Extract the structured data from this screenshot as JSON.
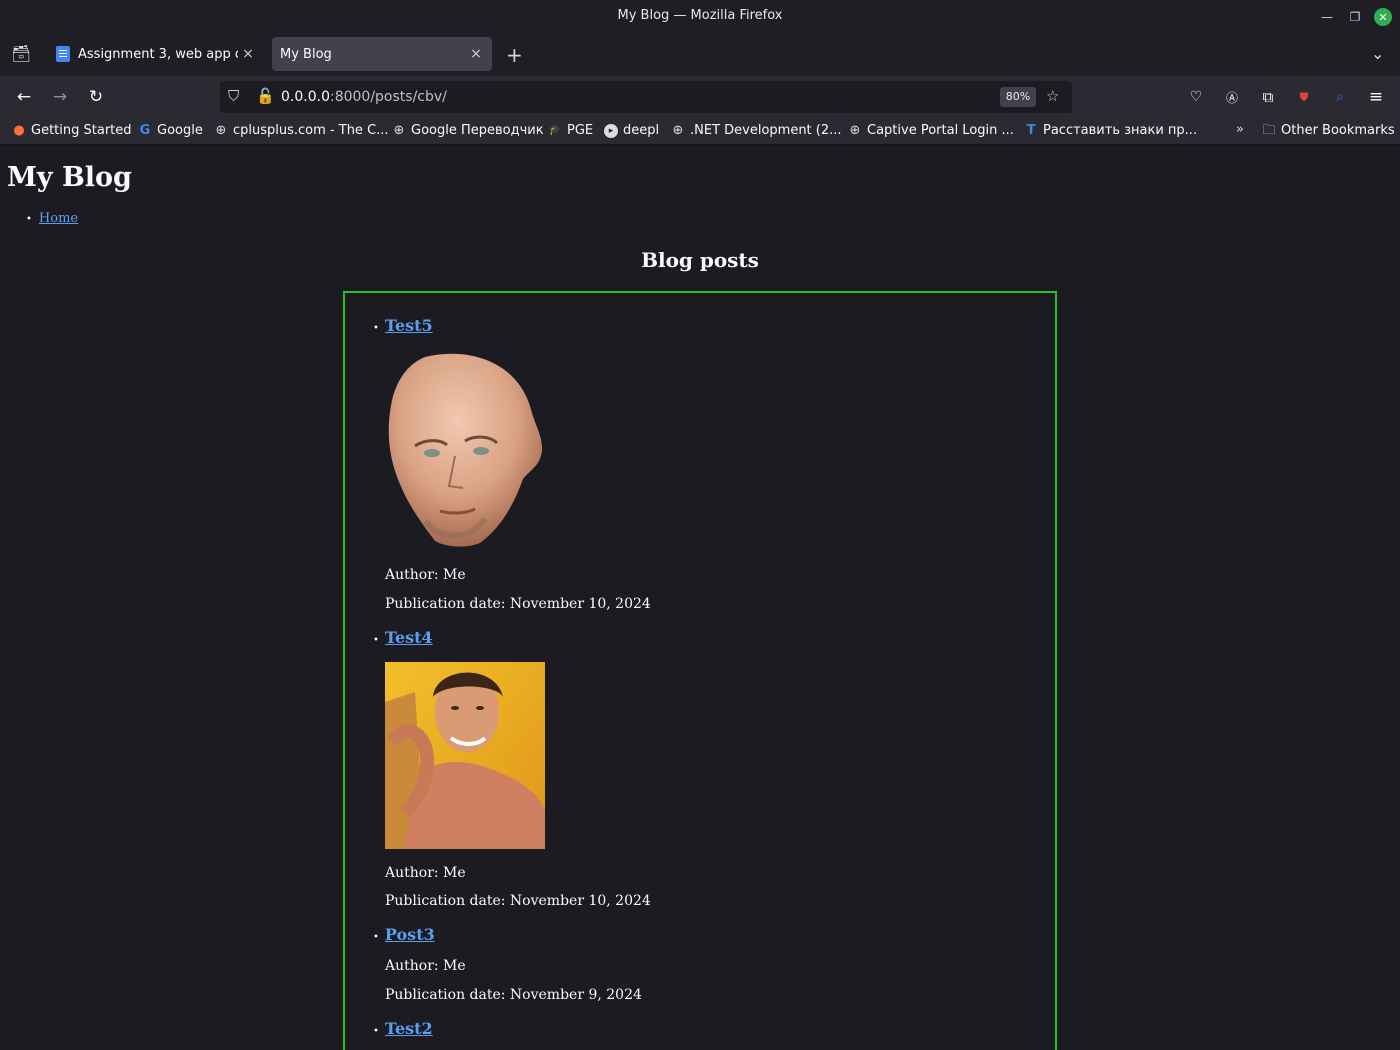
{
  "window": {
    "title": "My Blog — Mozilla Firefox",
    "minimize_icon": "minimize-icon",
    "maximize_icon": "maximize-icon",
    "close_icon": "close-icon"
  },
  "tabs": [
    {
      "label": "Assignment 3, web app dev",
      "active": false,
      "close": "×"
    },
    {
      "label": "My Blog",
      "active": true,
      "close": "×"
    }
  ],
  "toolbar": {
    "url_host": "0.0.0.0",
    "url_rest": ":8000/posts/cbv/",
    "zoom": "80%"
  },
  "bookmarks": [
    {
      "label": "Getting Started",
      "icon": "firefox-icon"
    },
    {
      "label": "Google",
      "icon": "google-icon"
    },
    {
      "label": "cplusplus.com - The C...",
      "icon": "globe-icon"
    },
    {
      "label": "Google Переводчик",
      "icon": "globe-icon"
    },
    {
      "label": "PGE",
      "icon": "pge-icon"
    },
    {
      "label": "deepl",
      "icon": "deepl-icon"
    },
    {
      "label": ".NET Development (2...",
      "icon": "globe-icon"
    },
    {
      "label": "Captive Portal Login ...",
      "icon": "globe-icon"
    },
    {
      "label": "Расставить знаки пр...",
      "icon": "t-icon"
    }
  ],
  "other_bookmarks": "Other Bookmarks",
  "page": {
    "site_title": "My Blog",
    "nav": [
      {
        "label": "Home"
      }
    ],
    "heading": "Blog posts",
    "posts": [
      {
        "title": "Test5",
        "author": "Author: Me",
        "date": "Publication date: November 10, 2024",
        "has_image": true
      },
      {
        "title": "Test4",
        "author": "Author: Me",
        "date": "Publication date: November 10, 2024",
        "has_image": true
      },
      {
        "title": "Post3",
        "author": "Author: Me",
        "date": "Publication date: November 9, 2024",
        "has_image": false
      },
      {
        "title": "Test2",
        "has_image": false
      }
    ]
  },
  "colors": {
    "link": "#5aa0f0",
    "box_border": "#22c322",
    "page_bg": "#1c1b22"
  }
}
